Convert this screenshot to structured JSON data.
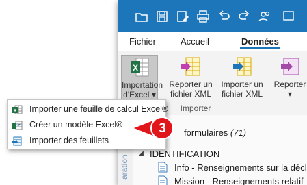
{
  "quick_access": {
    "icons": [
      "open-icon",
      "save-icon",
      "save-as-icon",
      "print-icon",
      "undo-icon",
      "redo-icon",
      "users-icon"
    ]
  },
  "tabs": [
    {
      "label": "Fichier",
      "active": false
    },
    {
      "label": "Accueil",
      "active": false
    },
    {
      "label": "Données",
      "active": true
    }
  ],
  "ribbon": {
    "import_excel": {
      "line1": "Importation",
      "line2": "d'Excel",
      "caret": "▾"
    },
    "export_xml": {
      "line1": "Reporter un",
      "line2": "fichier XML"
    },
    "import_xml": {
      "line1": "Importer un",
      "line2": "fichier XML"
    },
    "report_partial": {
      "line1": "Reporter",
      "caret": "▾"
    },
    "group_label": "Importer"
  },
  "content": {
    "side_label": "aration",
    "list_header": "formulaires",
    "list_count": "(71)",
    "tree_caret": "◢",
    "tree_section": "IDENTIFICATION",
    "items": [
      "Info - Renseignements sur la décl",
      "Mission - Renseignements relatif"
    ]
  },
  "dropdown_menu": {
    "items": [
      {
        "label": "Importer une feuille de calcul Excel®",
        "icon": "excel-sheet-icon"
      },
      {
        "label": "Créer un modèle Excel®",
        "icon": "template-icon"
      },
      {
        "label": "Importer des feuillets",
        "icon": "sheets-icon"
      }
    ]
  },
  "callout": {
    "number": "3",
    "color": "#e0161b"
  },
  "colors": {
    "accent": "#1c76b9",
    "excel_green": "#217346",
    "xml_yellow": "#f2c200",
    "purple": "#8e44ad"
  }
}
